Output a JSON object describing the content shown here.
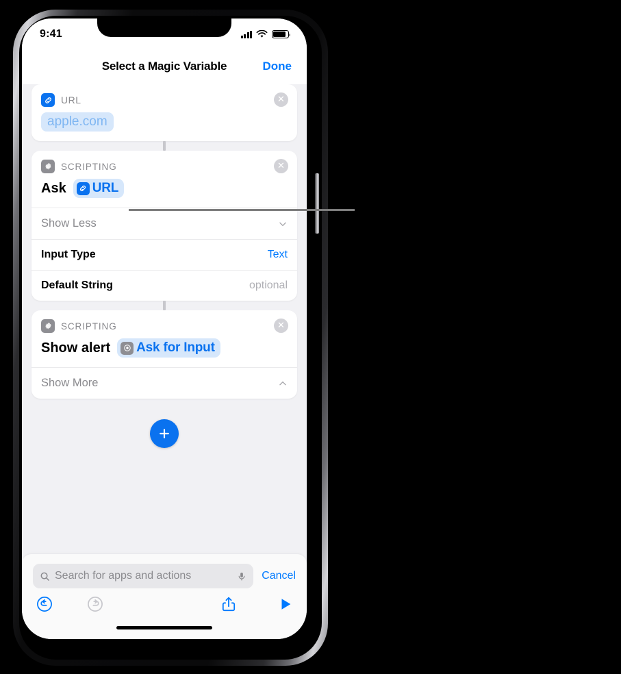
{
  "status_bar": {
    "time": "9:41",
    "cellular_icon": "signal-bars-icon",
    "wifi_icon": "wifi-icon",
    "battery_icon": "battery-icon"
  },
  "nav": {
    "title": "Select a Magic Variable",
    "done_label": "Done"
  },
  "cards": [
    {
      "app_icon": "url-link-icon",
      "header": "URL",
      "close": "✕",
      "pill_value": "apple.com"
    },
    {
      "app_icon": "scripting-gear-icon",
      "header": "SCRIPTING",
      "close": "✕",
      "action_text": "Ask",
      "token_icon": "url-link-icon",
      "token_text": "URL",
      "rows": [
        {
          "label": "Show Less",
          "value": "",
          "chevron": "chevron-down-icon"
        },
        {
          "label": "Input Type",
          "value": "Text"
        },
        {
          "label": "Default String",
          "value": "optional"
        }
      ]
    },
    {
      "app_icon": "scripting-gear-icon",
      "header": "SCRIPTING",
      "close": "✕",
      "action_text": "Show alert",
      "token_icon": "ask-for-input-icon",
      "token_text": "Ask for Input",
      "rows": [
        {
          "label": "Show More",
          "value": "",
          "chevron": "chevron-up-icon"
        }
      ]
    }
  ],
  "add_button": {
    "glyph": "+",
    "name": "add-action-button"
  },
  "search": {
    "placeholder": "Search for apps and actions",
    "search_icon": "search-icon",
    "mic_icon": "microphone-icon",
    "cancel_label": "Cancel"
  },
  "toolbar": {
    "undo": "undo-icon",
    "redo": "redo-icon",
    "share": "share-icon",
    "play": "play-icon"
  },
  "colors": {
    "accent_blue": "#007aff",
    "icon_blue": "#0a72ef",
    "token_bg": "#d6e7fb",
    "placeholder_gray": "#8a8a8e",
    "card_bg": "#ffffff",
    "page_bg": "#f1f1f4",
    "callout_line": "#7d7d7d"
  }
}
